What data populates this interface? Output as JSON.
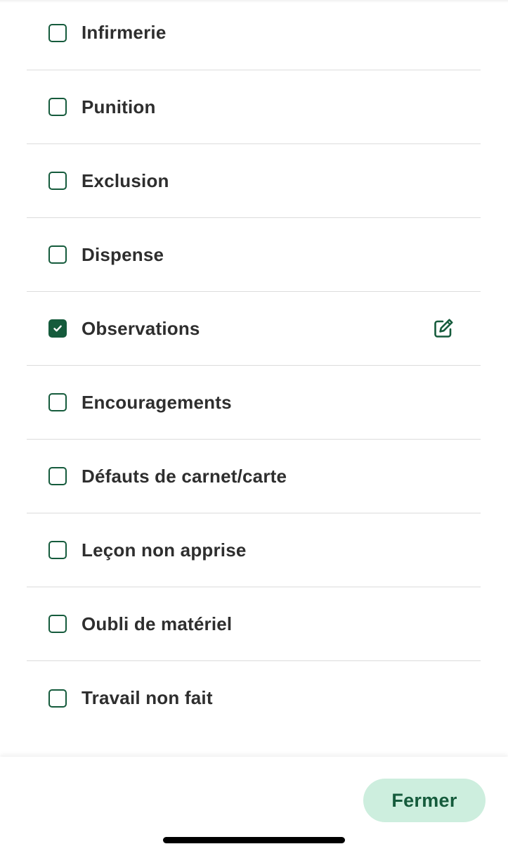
{
  "colors": {
    "accent": "#155b3c",
    "button_bg": "#cdeede",
    "divider": "#dcdcdc",
    "text": "#2e2e2e"
  },
  "options": [
    {
      "label": "Infirmerie",
      "checked": false
    },
    {
      "label": "Punition",
      "checked": false
    },
    {
      "label": "Exclusion",
      "checked": false
    },
    {
      "label": "Dispense",
      "checked": false
    },
    {
      "label": "Observations",
      "checked": true,
      "action_icon": "edit-icon"
    },
    {
      "label": "Encouragements",
      "checked": false
    },
    {
      "label": "Défauts de carnet/carte",
      "checked": false
    },
    {
      "label": "Leçon non apprise",
      "checked": false
    },
    {
      "label": "Oubli de matériel",
      "checked": false
    },
    {
      "label": "Travail non fait",
      "checked": false
    }
  ],
  "footer": {
    "close_label": "Fermer"
  }
}
